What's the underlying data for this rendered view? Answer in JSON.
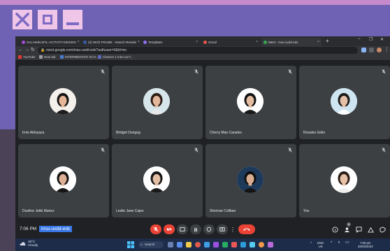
{
  "browser": {
    "tabs": [
      {
        "title": "SALAWIKAIFIL-ACTIVITY-DESIGN",
        "color": "#a64bd6",
        "active": false
      },
      {
        "title": "(2) NICE FRAME - Search Results",
        "color": "#3b5ba8",
        "active": false
      },
      {
        "title": "Templates",
        "color": "#8f6ff2",
        "active": false
      },
      {
        "title": "Gmail",
        "color": "#e65447",
        "active": false
      },
      {
        "title": "Meet - msu-uvdd-edx",
        "color": "#34a853",
        "active": true
      }
    ],
    "new_tab_glyph": "+",
    "address": "meet.google.com/msu-uvdd-edx?authuser=0&hl=en",
    "bookmarks": [
      {
        "label": "YouTube",
        "color": "#e53935"
      },
      {
        "label": "New tab",
        "color": "#9aa0a6"
      },
      {
        "label": "INTERMEDIATE SCH...",
        "color": "#4a7fd6"
      },
      {
        "label": "Classes 1 Intro sa F...",
        "color": "#5c6bc0"
      }
    ]
  },
  "meet": {
    "participants": [
      {
        "name": "Irnie Aldoyaza",
        "bg": "#f4f0ec",
        "shirt": "#1d1d1d",
        "skin": "#e4b596",
        "hair": "#151515"
      },
      {
        "name": "Bridget Dungog",
        "bg": "#d7e6ea",
        "shirt": "#e8e8e8",
        "skin": "#e2b79b",
        "hair": "#2a1c14"
      },
      {
        "name": "Cherry Mae Canales",
        "bg": "#ffffff",
        "shirt": "#1a1a1a",
        "skin": "#e5bda1",
        "hair": "#121212"
      },
      {
        "name": "Rosales Gelin",
        "bg": "#cfe5f2",
        "shirt": "#ffffff",
        "skin": "#e6c0a6",
        "hair": "#1b1b1b"
      },
      {
        "name": "Dustine Jebb Munez",
        "bg": "#ffffff",
        "shirt": "#161616",
        "skin": "#ddb095",
        "hair": "#141414"
      },
      {
        "name": "Leslie Jane Cajes",
        "bg": "#ffffff",
        "shirt": "#1a1a1a",
        "skin": "#e4bfa4",
        "hair": "#151515"
      },
      {
        "name": "Shernae Collbao",
        "bg": "#1e3a5a",
        "shirt": "#141414",
        "skin": "#d9ad92",
        "hair": "#0f0f0f"
      },
      {
        "name": "You",
        "bg": "#ffffff",
        "shirt": "#efefef",
        "skin": "#e7c2a8",
        "hair": "#2a1d16"
      }
    ],
    "time": "7:06 PM",
    "meeting_code": "msu-uvdd-edx",
    "people_count": "8"
  },
  "taskbar": {
    "temp": "28°C",
    "condition": "Cloudy",
    "search_label": "Search",
    "lang_top": "ENG",
    "lang_bottom": "US",
    "clock_time": "7:06 pm",
    "clock_date": "28/03/2023"
  }
}
